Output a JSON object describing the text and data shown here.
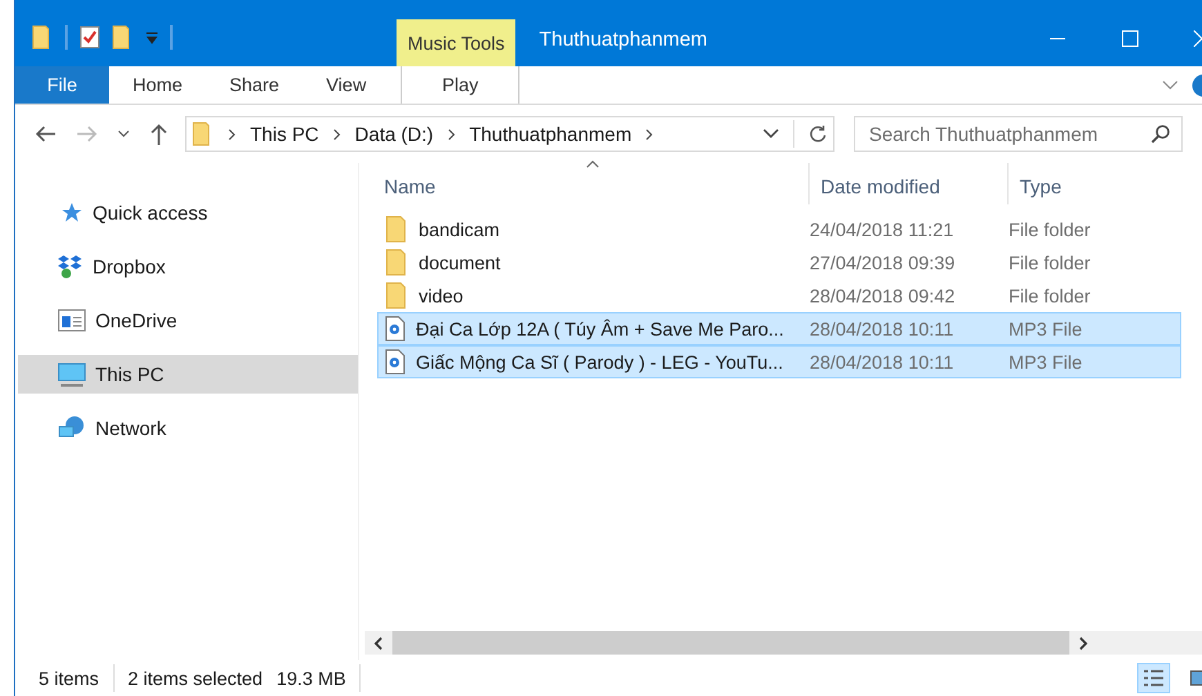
{
  "window": {
    "title": "Thuthuatphanmem",
    "context_tab": "Music Tools"
  },
  "ribbon_tabs": [
    {
      "label": "File",
      "kind": "file",
      "selected": false
    },
    {
      "label": "Home",
      "kind": "tab",
      "selected": false
    },
    {
      "label": "Share",
      "kind": "tab",
      "selected": false
    },
    {
      "label": "View",
      "kind": "tab",
      "selected": false
    },
    {
      "label": "Play",
      "kind": "context",
      "selected": false
    }
  ],
  "address_bar": {
    "path": [
      "This PC",
      "Data (D:)",
      "Thuthuatphanmem"
    ]
  },
  "search": {
    "placeholder": "Search Thuthuatphanmem"
  },
  "sidebar": {
    "items": [
      {
        "label": "Quick access",
        "kind": "star",
        "selected": false
      },
      {
        "label": "Dropbox",
        "kind": "dropbox",
        "selected": false
      },
      {
        "label": "OneDrive",
        "kind": "onedrive",
        "selected": false
      },
      {
        "label": "This PC",
        "kind": "pc",
        "selected": true
      },
      {
        "label": "Network",
        "kind": "network",
        "selected": false
      }
    ]
  },
  "table": {
    "columns": [
      "Name",
      "Date modified",
      "Type"
    ],
    "rows": [
      {
        "name": "bandicam",
        "date": "24/04/2018 11:21",
        "type": "File folder",
        "kind": "folder",
        "selected": false
      },
      {
        "name": "document",
        "date": "27/04/2018 09:39",
        "type": "File folder",
        "kind": "folder",
        "selected": false
      },
      {
        "name": "video",
        "date": "28/04/2018 09:42",
        "type": "File folder",
        "kind": "folder",
        "selected": false
      },
      {
        "name": "Đại Ca Lớp 12A ( Túy Âm + Save Me Paro...",
        "date": "28/04/2018 10:11",
        "type": "MP3 File",
        "kind": "audio",
        "selected": true
      },
      {
        "name": "Giấc Mộng Ca Sĩ ( Parody ) - LEG - YouTu...",
        "date": "28/04/2018 10:11",
        "type": "MP3 File",
        "kind": "audio",
        "selected": true
      }
    ]
  },
  "status_bar": {
    "count": "5 items",
    "selection": "2 items selected",
    "size": "19.3 MB"
  }
}
